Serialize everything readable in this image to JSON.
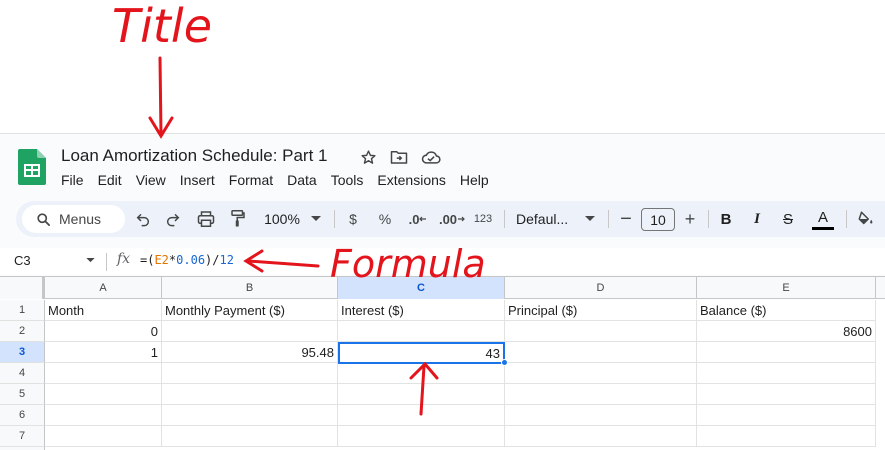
{
  "annotations": {
    "title_label": "Title",
    "formula_label": "Formula",
    "color": "#e3141c"
  },
  "app": {
    "doc_title": "Loan Amortization Schedule: Part 1",
    "title_icons": [
      "star-icon",
      "move-to-folder-icon",
      "cloud-saved-icon"
    ],
    "menu": [
      "File",
      "Edit",
      "View",
      "Insert",
      "Format",
      "Data",
      "Tools",
      "Extensions",
      "Help"
    ]
  },
  "toolbar": {
    "search_label": "Menus",
    "zoom": "100%",
    "currency": "$",
    "percent": "%",
    "decrease_decimal": ".0",
    "increase_decimal": ".00",
    "more_formats": "123",
    "font": "Defaul...",
    "font_size": "10",
    "decrease_font": "−",
    "increase_font": "+",
    "bold": "B",
    "italic": "I",
    "strikethrough": "S",
    "text_color_label": "A",
    "text_color": "#000000"
  },
  "formula_bar": {
    "name_box": "C3",
    "fx": "fx",
    "formula_parts": [
      "=(",
      "E2",
      "*",
      "0.06",
      ")/",
      "12"
    ]
  },
  "sheet": {
    "columns": [
      "A",
      "B",
      "C",
      "D",
      "E"
    ],
    "rows": [
      "1",
      "2",
      "3",
      "4",
      "5",
      "6",
      "7"
    ],
    "selected_column": "C",
    "selected_row": "3",
    "cells": {
      "A1": "Month",
      "B1": "Monthly Payment ($)",
      "C1": "Interest ($)",
      "D1": "Principal ($)",
      "E1": "Balance ($)",
      "A2": "0",
      "E2": "8600",
      "A3": "1",
      "B3": "95.48",
      "C3": "43"
    }
  }
}
